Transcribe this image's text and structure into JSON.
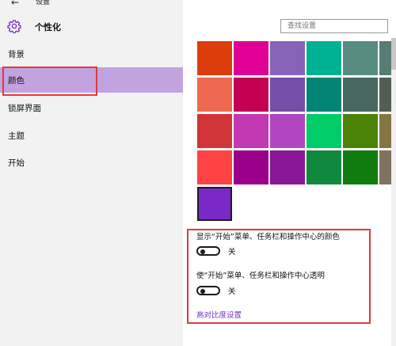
{
  "window": {
    "title": "设置"
  },
  "header": {
    "page_title": "个性化"
  },
  "search": {
    "placeholder": "查找设置"
  },
  "sidebar": {
    "items": [
      {
        "label": "背景",
        "selected": false
      },
      {
        "label": "颜色",
        "selected": true
      },
      {
        "label": "锁屏界面",
        "selected": false
      },
      {
        "label": "主题",
        "selected": false
      },
      {
        "label": "开始",
        "selected": false
      }
    ]
  },
  "colors": {
    "accent_selected": "#c2a3e0",
    "highlight_box": "#e03a3a",
    "link": "#7a34c8",
    "rows": [
      [
        "#dc3d0a",
        "#e00096",
        "#8764b8",
        "#00b294",
        "#568c7f",
        "#567c73"
      ],
      [
        "#ef6950",
        "#c30052",
        "#744da9",
        "#018574",
        "#486860",
        "#525e54"
      ],
      [
        "#d13438",
        "#c239b3",
        "#b146c2",
        "#00cc6a",
        "#498205",
        "#847545"
      ],
      [
        "#ff4343",
        "#9a0089",
        "#881798",
        "#10893e",
        "#107c10",
        "#7e735f"
      ],
      [
        "#7b28c8"
      ]
    ],
    "selected_index": [
      4,
      0
    ]
  },
  "options": {
    "show_color_label": "显示“开始”菜单、任务栏和操作中心的颜色",
    "show_color_state": "关",
    "transparent_label": "使“开始”菜单、任务栏和操作中心透明",
    "transparent_state": "关",
    "high_contrast_link": "高对比度设置"
  }
}
